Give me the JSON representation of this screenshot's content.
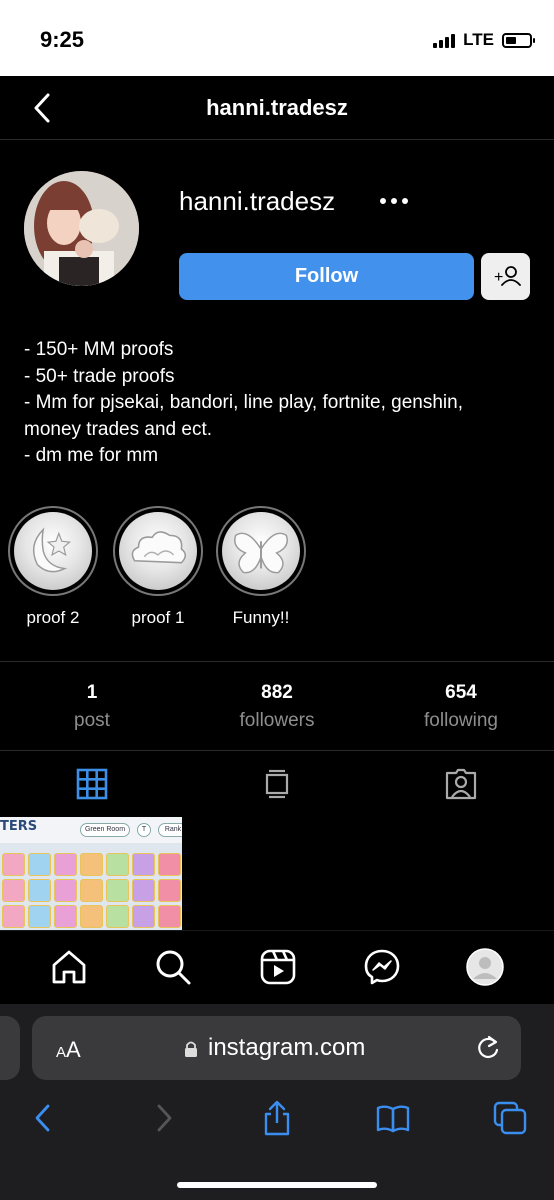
{
  "status_bar": {
    "time": "9:25",
    "network": "LTE",
    "battery_level": 0.45
  },
  "header": {
    "title": "hanni.tradesz"
  },
  "profile": {
    "username": "hanni.tradesz",
    "follow_label": "Follow",
    "bio": [
      "- 150+ MM proofs",
      "- 50+ trade proofs",
      "- Mm for pjsekai, bandori, line play, fortnite, genshin,",
      "money trades and ect.",
      "- dm me for mm"
    ]
  },
  "highlights": [
    {
      "label": "proof 2",
      "icon": "moon-icon"
    },
    {
      "label": "proof 1",
      "icon": "cloud-icon"
    },
    {
      "label": "Funny!!",
      "icon": "butterfly-icon"
    }
  ],
  "stats": [
    {
      "value": "1",
      "label": "post"
    },
    {
      "value": "882",
      "label": "followers"
    },
    {
      "value": "654",
      "label": "following"
    }
  ],
  "post_thumbnail": {
    "title": "TERS",
    "button_1": "Green Room",
    "button_2": "T",
    "button_3": "Rank"
  },
  "browser": {
    "url": "instagram.com",
    "aa": "AA"
  },
  "colors": {
    "accent": "#4291ec",
    "background": "#000000",
    "muted": "#8e8e8e"
  }
}
